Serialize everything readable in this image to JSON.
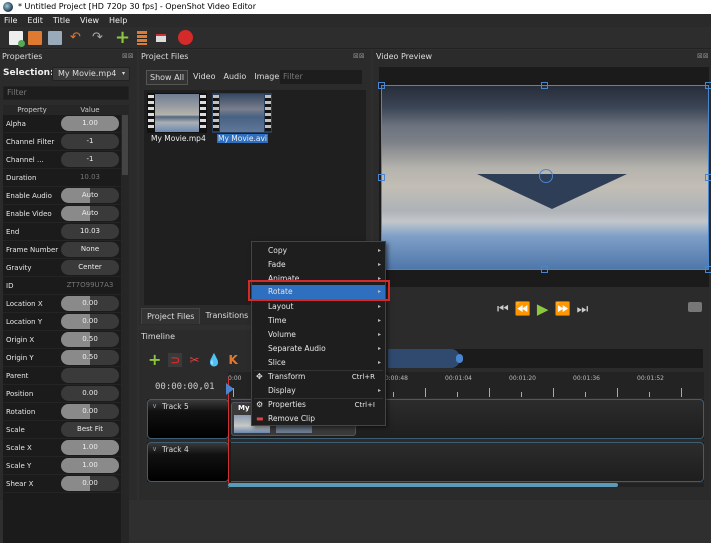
{
  "window": {
    "title": "* Untitled Project [HD 720p 30 fps] - OpenShot Video Editor"
  },
  "menubar": [
    "File",
    "Edit",
    "Title",
    "View",
    "Help"
  ],
  "toolbar": {
    "icons": [
      "new-project-icon",
      "open-project-icon",
      "save-project-icon",
      "undo-icon",
      "redo-icon",
      "import-files-icon",
      "choose-profile-icon",
      "fullscreen-icon",
      "export-video-icon"
    ]
  },
  "properties": {
    "title": "Properties",
    "selection_label": "Selection:",
    "selection_value": "My Movie.mp4",
    "filter_placeholder": "Filter",
    "col_property": "Property",
    "col_value": "Value",
    "rows": [
      {
        "name": "Alpha",
        "value": "1.00",
        "fill": 1.0
      },
      {
        "name": "Channel Filter",
        "value": "-1",
        "fill": 0
      },
      {
        "name": "Channel ...",
        "value": "-1",
        "fill": 0
      },
      {
        "name": "Duration",
        "value": "10.03",
        "plain": true
      },
      {
        "name": "Enable Audio",
        "value": "Auto",
        "fill": 0.5
      },
      {
        "name": "Enable Video",
        "value": "Auto",
        "fill": 0.5
      },
      {
        "name": "End",
        "value": "10.03",
        "fill": 0
      },
      {
        "name": "Frame Number",
        "value": "None",
        "fill": 0
      },
      {
        "name": "Gravity",
        "value": "Center",
        "fill": 0
      },
      {
        "name": "ID",
        "value": "ZT7O99U7A3",
        "plain": true
      },
      {
        "name": "Location X",
        "value": "0.00",
        "fill": 0.5
      },
      {
        "name": "Location Y",
        "value": "0.00",
        "fill": 0.5
      },
      {
        "name": "Origin X",
        "value": "0.50",
        "fill": 0.5
      },
      {
        "name": "Origin Y",
        "value": "0.50",
        "fill": 0.5
      },
      {
        "name": "Parent",
        "value": "",
        "fill": 0
      },
      {
        "name": "Position",
        "value": "0.00",
        "fill": 0
      },
      {
        "name": "Rotation",
        "value": "0.00",
        "fill": 0.5
      },
      {
        "name": "Scale",
        "value": "Best Fit",
        "fill": 0
      },
      {
        "name": "Scale X",
        "value": "1.00",
        "fill": 1.0
      },
      {
        "name": "Scale Y",
        "value": "1.00",
        "fill": 1.0
      },
      {
        "name": "Shear X",
        "value": "0.00",
        "fill": 0.5
      }
    ]
  },
  "project_files": {
    "title": "Project Files",
    "tabs": [
      "Show All",
      "Video",
      "Audio",
      "Image"
    ],
    "active_tab": "Show All",
    "filter_placeholder": "Filter",
    "files": [
      {
        "name": "My Movie.mp4",
        "selected": false
      },
      {
        "name": "My Movie.avi",
        "selected": true
      }
    ]
  },
  "bottom_tabs": [
    "Project Files",
    "Transitions"
  ],
  "video_preview": {
    "title": "Video Preview"
  },
  "timeline": {
    "title": "Timeline",
    "current_time": "00:00:00,01",
    "ruler_labels": [
      "0:00",
      "00:00:48",
      "00:01:04",
      "00:01:20",
      "00:01:36",
      "00:01:52"
    ],
    "tracks": [
      {
        "name": "Track 5",
        "clip_label": "My"
      },
      {
        "name": "Track 4"
      }
    ]
  },
  "context_menu": {
    "items": [
      {
        "label": "Copy",
        "submenu": true
      },
      {
        "label": "Fade",
        "submenu": true
      },
      {
        "label": "Animate",
        "submenu": true
      },
      {
        "label": "Rotate",
        "submenu": true,
        "highlighted": true
      },
      {
        "label": "Layout",
        "submenu": true
      },
      {
        "label": "Time",
        "submenu": true
      },
      {
        "label": "Volume",
        "submenu": true
      },
      {
        "label": "Separate Audio",
        "submenu": true
      },
      {
        "label": "Slice",
        "submenu": true
      },
      {
        "label": "Transform",
        "shortcut": "Ctrl+R",
        "icon": "move-icon"
      },
      {
        "label": "Display",
        "submenu": true
      },
      {
        "label": "Properties",
        "shortcut": "Ctrl+I",
        "icon": "gear-icon"
      },
      {
        "label": "Remove Clip",
        "icon": "remove-icon"
      }
    ]
  },
  "colors": {
    "accent": "#2f6fbf",
    "highlight_box": "#d42a2a",
    "play": "#8dc63f"
  }
}
